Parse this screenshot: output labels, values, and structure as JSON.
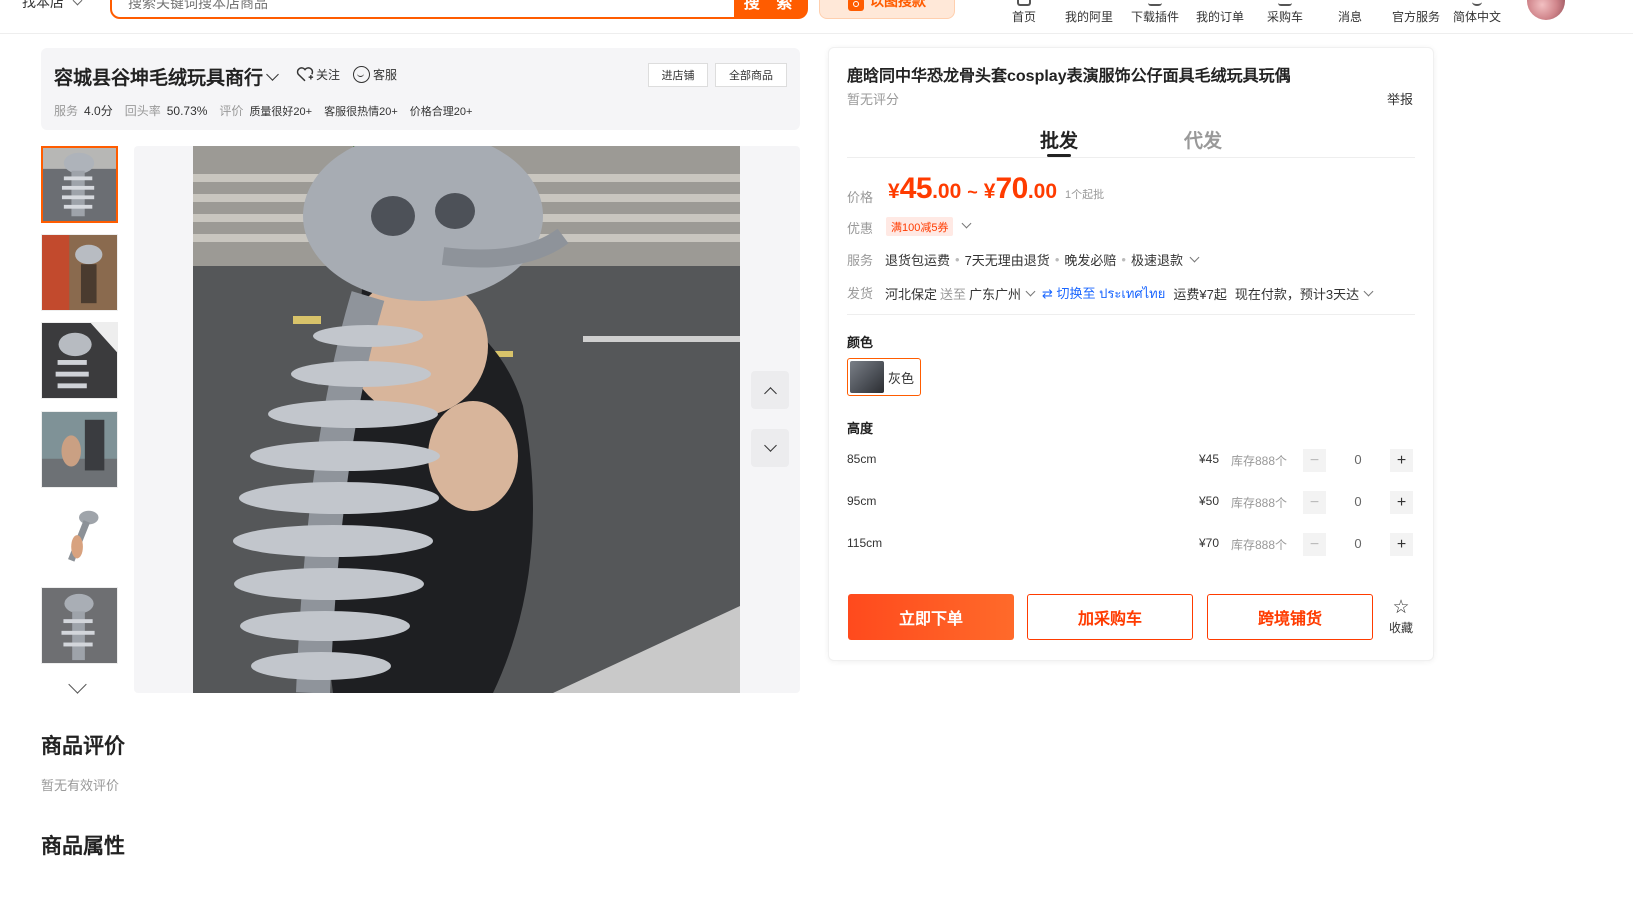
{
  "topbar": {
    "scope_label": "找本店",
    "search_placeholder": "搜索关键词搜本店商品",
    "search_button": "搜 索",
    "image_search": "以图搜款",
    "nav": [
      {
        "label": "首页",
        "icon": "home-icon"
      },
      {
        "label": "我的阿里",
        "icon": "user-icon"
      },
      {
        "label": "下载插件",
        "icon": "plugin-icon"
      },
      {
        "label": "我的订单",
        "icon": "order-icon"
      },
      {
        "label": "采购车",
        "icon": "cart-icon"
      },
      {
        "label": "消息",
        "icon": "message-icon"
      },
      {
        "label": "官方服务",
        "icon": "service-icon"
      },
      {
        "label": "简体中文",
        "icon": "language-icon"
      }
    ]
  },
  "shop": {
    "name": "容城县谷坤毛绒玩具商行",
    "follow": "关注",
    "service": "客服",
    "enter_shop": "进店铺",
    "all_products": "全部商品",
    "rating_label": "服务",
    "rating_value": "4.0分",
    "repurchase_label": "回头率",
    "repurchase_value": "50.73%",
    "review_label": "评价",
    "tags": [
      "质量很好20+",
      "客服很热情20+",
      "价格合理20+"
    ]
  },
  "gallery": {
    "thumb_count": 6,
    "active_index": 0
  },
  "sections": {
    "reviews_title": "商品评价",
    "reviews_empty": "暂无有效评价",
    "attributes_title": "商品属性"
  },
  "product": {
    "title": "鹿晗同中华恐龙骨头套cosplay表演服饰公仔面具毛绒玩具玩偶",
    "score": "暂无评分",
    "report": "举报",
    "tabs": [
      "批发",
      "代发"
    ],
    "price_label": "价格",
    "currency": "¥",
    "price_low_int": "45",
    "price_low_dec": ".00",
    "price_tilde": "~",
    "price_high_int": "70",
    "price_high_dec": ".00",
    "moq": "1个起批",
    "discount_label": "优惠",
    "coupon": "满100减5券",
    "service_label": "服务",
    "services": [
      "退货包运费",
      "7天无理由退货",
      "晚发必赔",
      "极速退款"
    ],
    "ship_label": "发货",
    "ship_from": "河北保定",
    "ship_to_word": "送至",
    "ship_to": "广东广州",
    "switch_to": "⇄ 切换至 ประเทศไทย",
    "freight": "运费¥7起",
    "delivery": "现在付款，预计3天达",
    "color_label": "颜色",
    "color_option": "灰色",
    "height_label": "高度",
    "sizes": [
      {
        "size": "85cm",
        "price": "¥45",
        "stock": "库存888个",
        "qty": "0"
      },
      {
        "size": "95cm",
        "price": "¥50",
        "stock": "库存888个",
        "qty": "0"
      },
      {
        "size": "115cm",
        "price": "¥70",
        "stock": "库存888个",
        "qty": "0"
      }
    ],
    "buy_now": "立即下单",
    "add_cart": "加采购车",
    "cross_border": "跨境铺货",
    "favorite": "收藏"
  },
  "colors": {
    "accent": "#ff5c00",
    "price": "#ff3b00",
    "link": "#1a66ff"
  }
}
